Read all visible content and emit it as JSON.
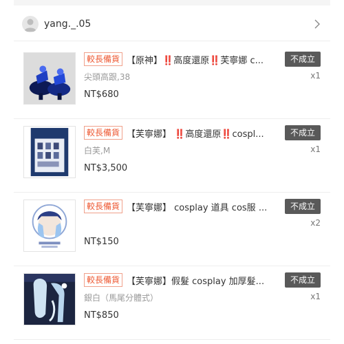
{
  "shop": {
    "name": "yang._.05",
    "avatar_icon": "user-avatar-icon",
    "nav_icon": "chevron-right-icon"
  },
  "items": [
    {
      "badge": "較長備貨",
      "title": "【原神】‼️高度還原‼️芙寧娜 c...",
      "status": "不成立",
      "variant": "尖頭高跟,38",
      "quantity": "x1",
      "price": "NT$680"
    },
    {
      "badge": "較長備貨",
      "title": "【芙寧娜】 ‼️高度還原‼️cospl...",
      "status": "不成立",
      "variant": "白芙,M",
      "quantity": "x1",
      "price": "NT$3,500"
    },
    {
      "badge": "較長備貨",
      "title": "【芙寧娜】 cosplay 道具 cos服 ...",
      "status": "不成立",
      "variant": "",
      "quantity": "x2",
      "price": "NT$150"
    },
    {
      "badge": "較長備貨",
      "title": "【芙寧娜】假髮 cosplay 加厚髮...",
      "status": "不成立",
      "variant": "銀白（馬尾分體式）",
      "quantity": "x1",
      "price": "NT$850"
    }
  ],
  "colors": {
    "stock_badge": "#ee5a34",
    "status_badge": "#595959",
    "price": "#333333"
  }
}
